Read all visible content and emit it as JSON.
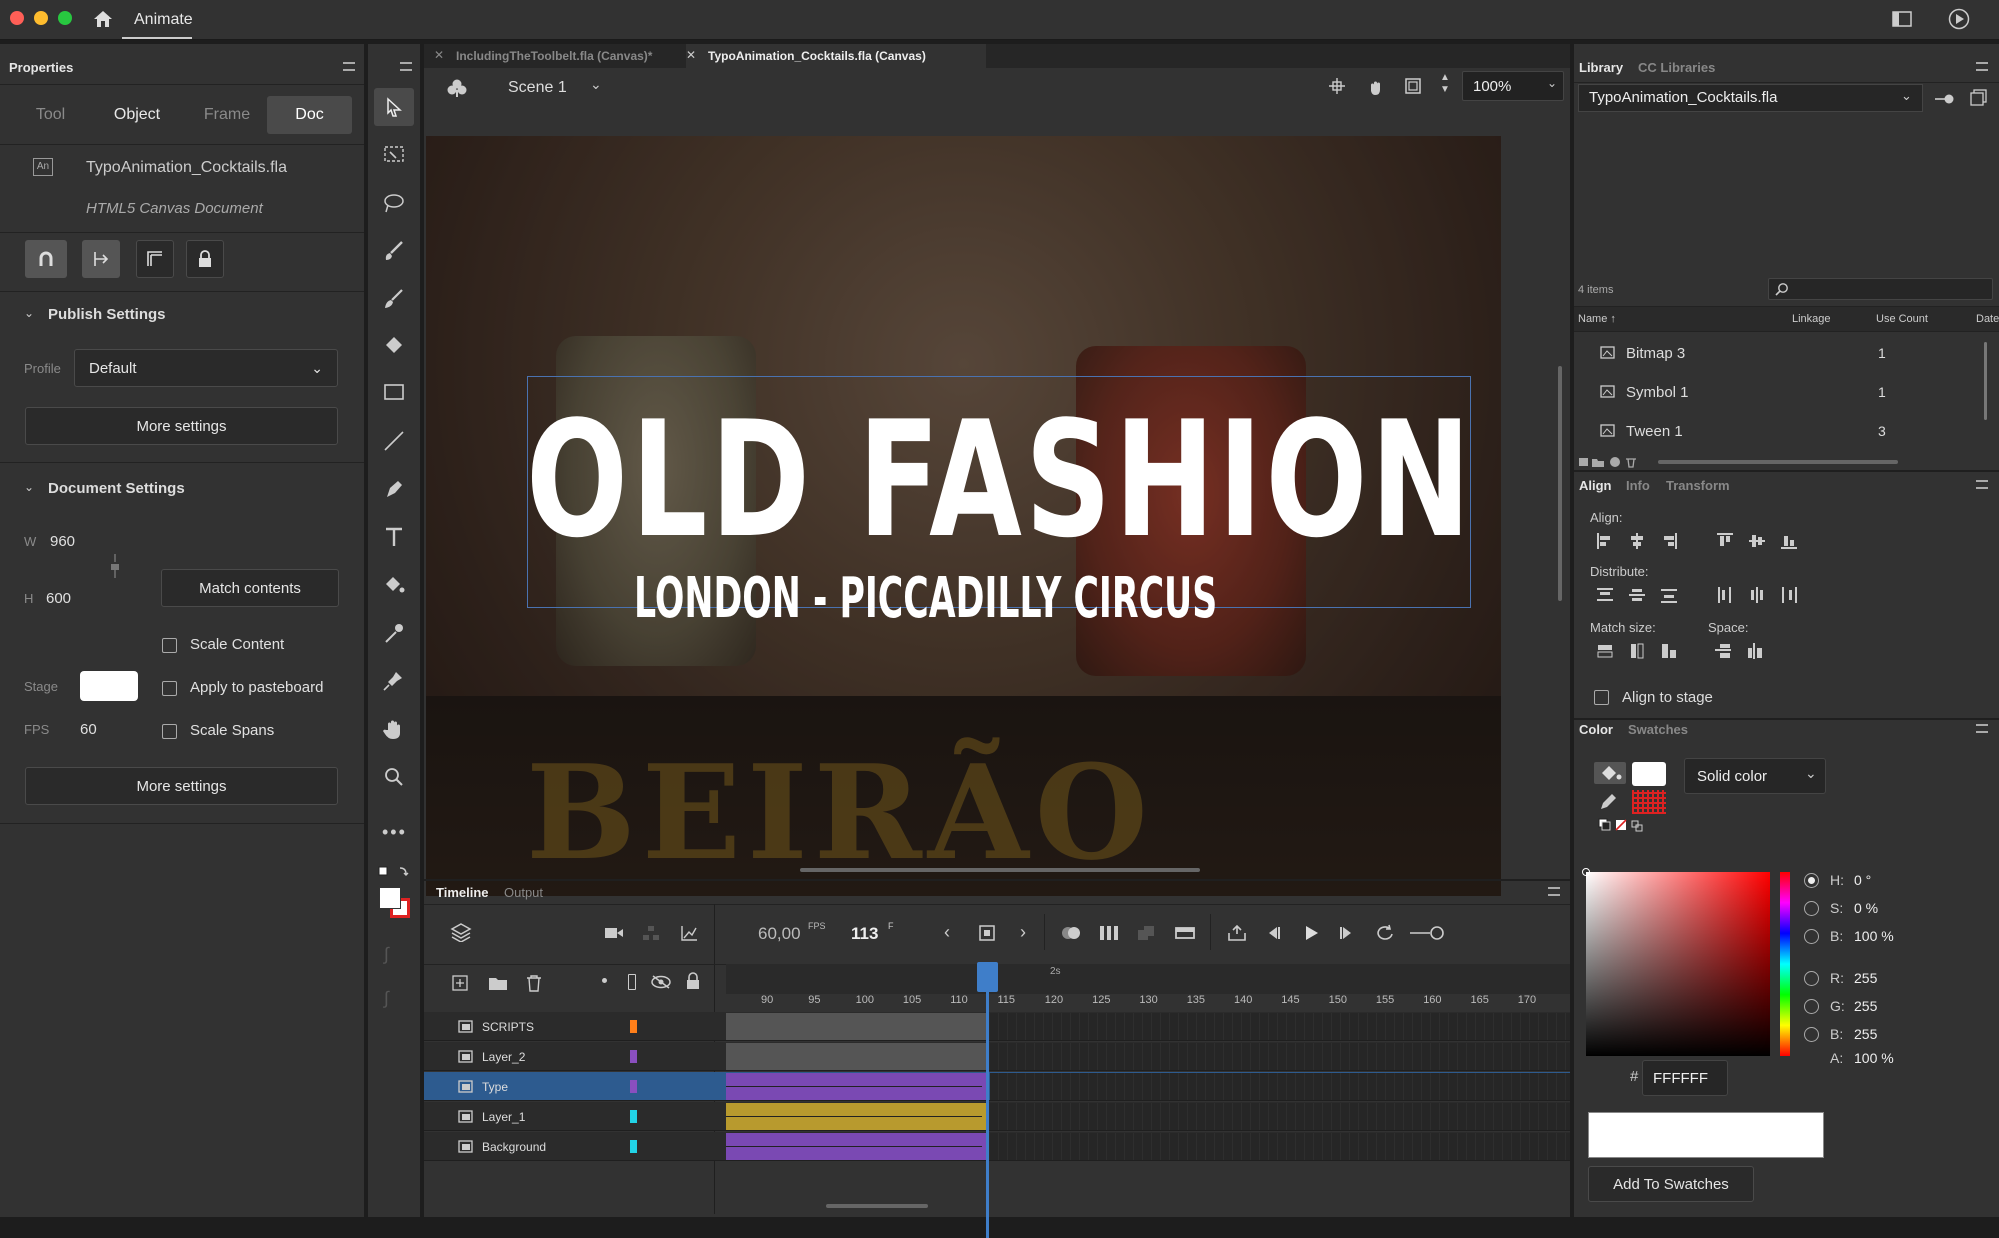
{
  "app": {
    "name": "Animate"
  },
  "colors": {
    "accent": "#2d5b8f",
    "type_layer": "#8a4fbf",
    "layer1": "#b89a2e",
    "bg_layer": "#7a49b3"
  },
  "properties": {
    "title": "Properties",
    "tabs": [
      "Tool",
      "Object",
      "Frame",
      "Doc"
    ],
    "file_name": "TypoAnimation_Cocktails.fla",
    "doc_type": "HTML5 Canvas Document",
    "publish": {
      "header": "Publish Settings",
      "profile_label": "Profile",
      "profile_value": "Default",
      "more": "More settings"
    },
    "document": {
      "header": "Document Settings",
      "w_label": "W",
      "w": "960",
      "h_label": "H",
      "h": "600",
      "match": "Match contents",
      "scale_content": "Scale Content",
      "stage_label": "Stage",
      "apply_pasteboard": "Apply to pasteboard",
      "fps_label": "FPS",
      "fps": "60",
      "scale_spans": "Scale Spans",
      "more": "More settings"
    }
  },
  "doc_tabs": [
    {
      "label": "IncludingTheToolbelt.fla (Canvas)*"
    },
    {
      "label": "TypoAnimation_Cocktails.fla (Canvas)"
    }
  ],
  "stage": {
    "scene": "Scene 1",
    "zoom": "100%",
    "title": "OLD FASHION",
    "subtitle": "LONDON - PICCADILLY CIRCUS",
    "bg_text": "BEIRÃO"
  },
  "timeline": {
    "tabs": [
      "Timeline",
      "Output"
    ],
    "fps": "60,00",
    "fps_unit": "FPS",
    "frame": "113",
    "frame_unit": "F",
    "ruler_label": "2s",
    "ruler": [
      "90",
      "95",
      "100",
      "105",
      "110",
      "115",
      "120",
      "125",
      "130",
      "135",
      "140",
      "145",
      "150",
      "155",
      "160",
      "165",
      "170"
    ],
    "layers": [
      {
        "name": "SCRIPTS",
        "color": "#ff7f1a"
      },
      {
        "name": "Layer_2",
        "color": "#8a4fbf"
      },
      {
        "name": "Type",
        "color": "#8a4fbf"
      },
      {
        "name": "Layer_1",
        "color": "#22d3e6"
      },
      {
        "name": "Background",
        "color": "#22d3e6"
      }
    ]
  },
  "library": {
    "tabs": [
      "Library",
      "CC Libraries"
    ],
    "file": "TypoAnimation_Cocktails.fla",
    "count": "4 items",
    "cols": [
      "Name",
      "Linkage",
      "Use Count",
      "Date"
    ],
    "items": [
      {
        "name": "Bitmap 3",
        "count": "1"
      },
      {
        "name": "Symbol 1",
        "count": "1"
      },
      {
        "name": "Tween 1",
        "count": "3"
      }
    ]
  },
  "align": {
    "tabs": [
      "Align",
      "Info",
      "Transform"
    ],
    "align_label": "Align:",
    "distribute_label": "Distribute:",
    "match_label": "Match size:",
    "space_label": "Space:",
    "to_stage": "Align to stage"
  },
  "color": {
    "tabs": [
      "Color",
      "Swatches"
    ],
    "mode": "Solid color",
    "h": "0 °",
    "s": "0 %",
    "b": "100 %",
    "r": "255",
    "g": "255",
    "bv": "255",
    "a": "100 %",
    "hex": "FFFFFF",
    "hex_label": "#",
    "add": "Add To Swatches",
    "labels": {
      "h": "H:",
      "s": "S:",
      "b": "B:",
      "r": "R:",
      "g": "G:",
      "bb": "B:",
      "a": "A:"
    }
  }
}
